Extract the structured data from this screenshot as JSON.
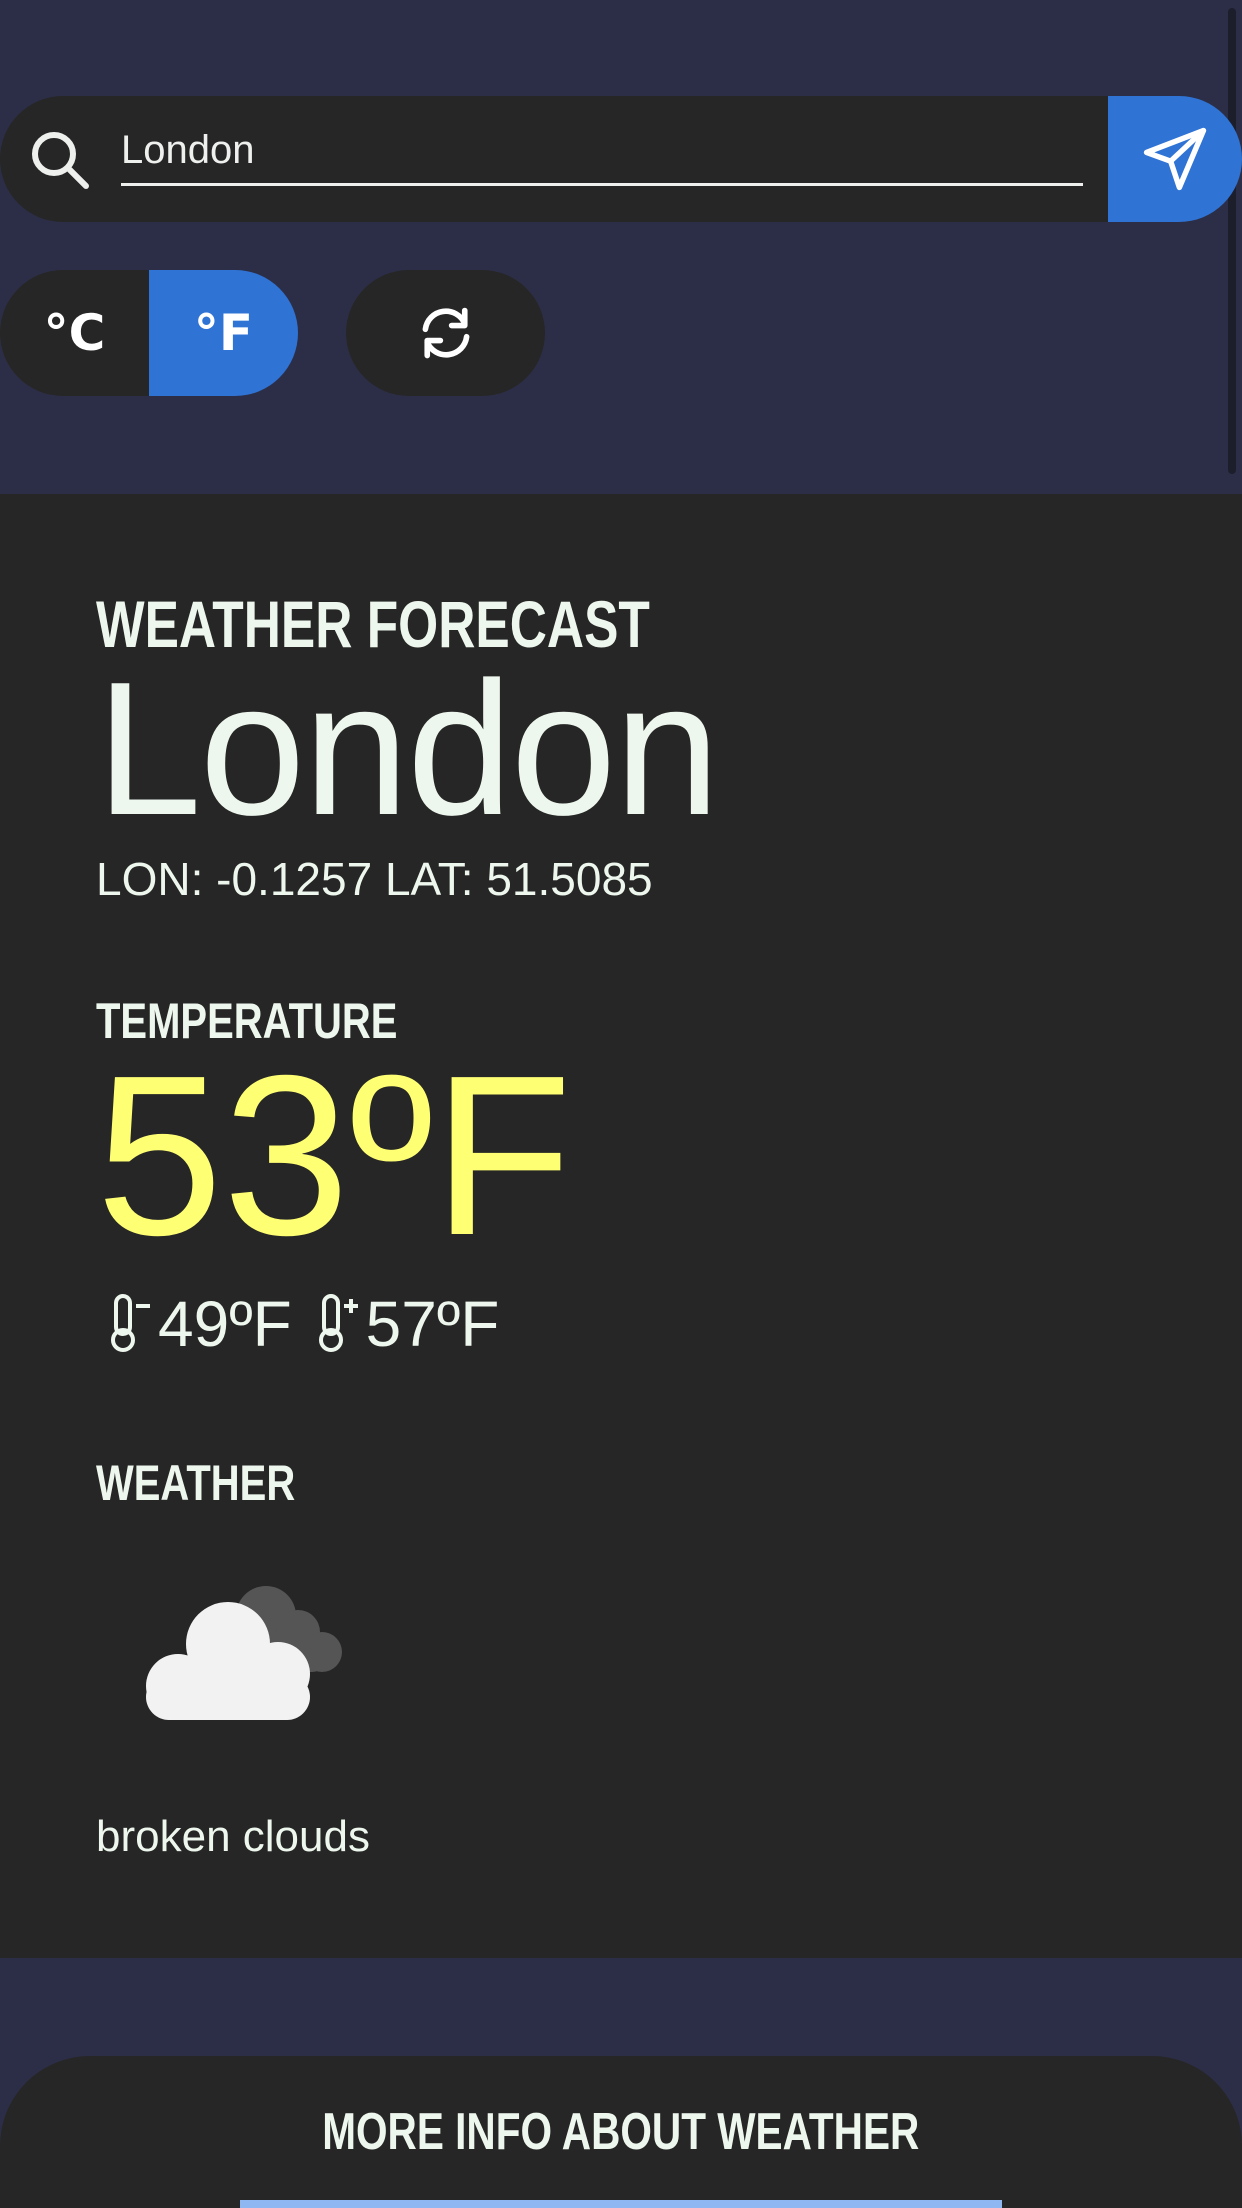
{
  "search": {
    "value": "London",
    "icon": "search-icon",
    "submit_icon": "send-icon"
  },
  "units": {
    "celsius_label": "°C",
    "fahrenheit_label": "°F",
    "selected": "°F"
  },
  "refresh_icon": "refresh-icon",
  "forecast": {
    "heading": "WEATHER FORECAST",
    "city": "London",
    "coords": "LON: -0.1257 LAT: 51.5085",
    "temperature_heading": "TEMPERATURE",
    "temperature": "53ºF",
    "min_temp": "49ºF",
    "max_temp": "57ºF",
    "weather_heading": "WEATHER",
    "weather_icon": "broken-clouds-icon",
    "description": "broken clouds"
  },
  "more_info": {
    "title": "MORE INFO ABOUT WEATHER"
  },
  "colors": {
    "background": "#2c2e47",
    "card": "#262626",
    "accent": "#2f73d4",
    "temperature": "#ffff74",
    "text": "#eef7ee"
  }
}
